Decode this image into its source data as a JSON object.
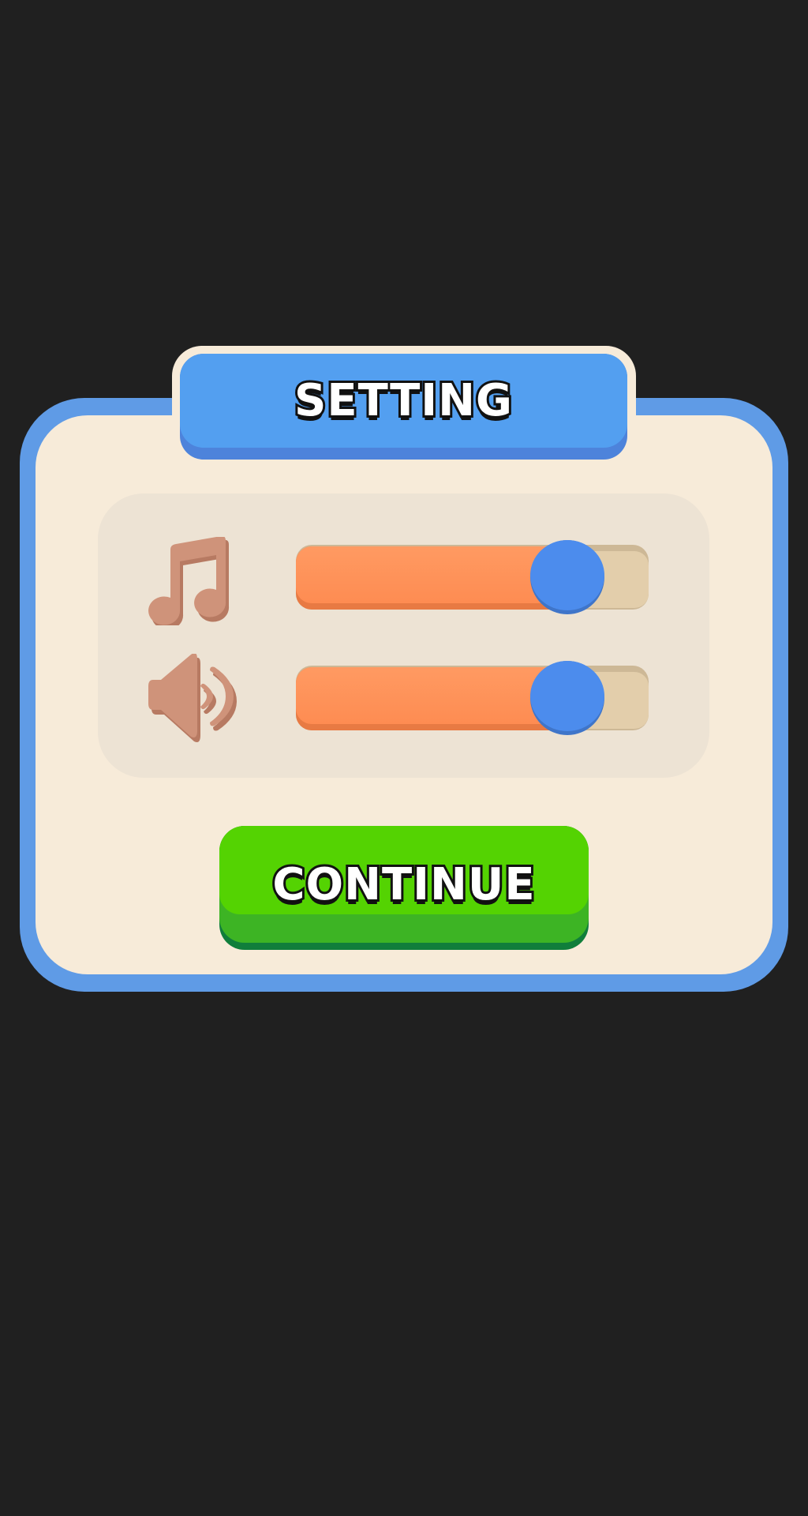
{
  "header": {
    "title": "SETTING"
  },
  "settings": {
    "music": {
      "icon": "music-note-icon",
      "level": 0.77
    },
    "sound": {
      "icon": "speaker-icon",
      "level": 0.77
    }
  },
  "buttons": {
    "continue_label": "CONTINUE"
  },
  "colors": {
    "background": "#202020",
    "panel_border": "#5f9be6",
    "panel_fill": "#f7ebd9",
    "header_blue": "#539ff0",
    "slider_fill": "#fe8c52",
    "slider_track": "#e3ceab",
    "slider_knob": "#4c8ced",
    "icon_color": "#cf937a",
    "continue_green": "#54d302"
  }
}
